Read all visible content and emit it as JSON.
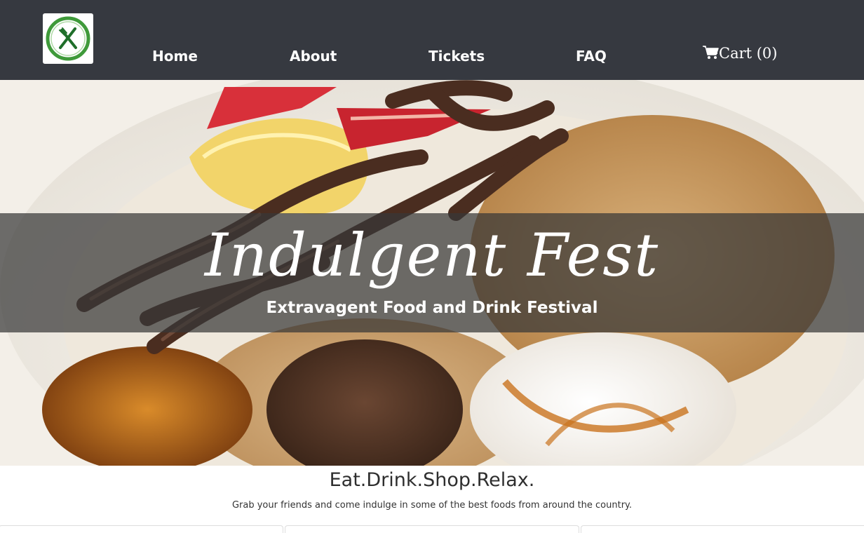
{
  "nav": {
    "items": [
      {
        "label": "Home"
      },
      {
        "label": "About"
      },
      {
        "label": "Tickets"
      },
      {
        "label": "FAQ"
      }
    ],
    "cart_label": "Cart (0)"
  },
  "hero": {
    "title": "Indulgent Fest",
    "subtitle": "Extravagent Food and Drink Festival"
  },
  "intro": {
    "tagline": "Eat.Drink.Shop.Relax.",
    "text": "Grab your friends and come indulge in some of the best foods from around the country."
  },
  "icons": {
    "logo": "fork-knife-logo-icon",
    "cart": "shopping-cart-icon"
  },
  "colors": {
    "navbar": "#363940",
    "logo_green": "#3f9a3a",
    "banner_overlay": "rgba(55,55,55,0.72)",
    "text_on_dark": "#ffffff"
  }
}
